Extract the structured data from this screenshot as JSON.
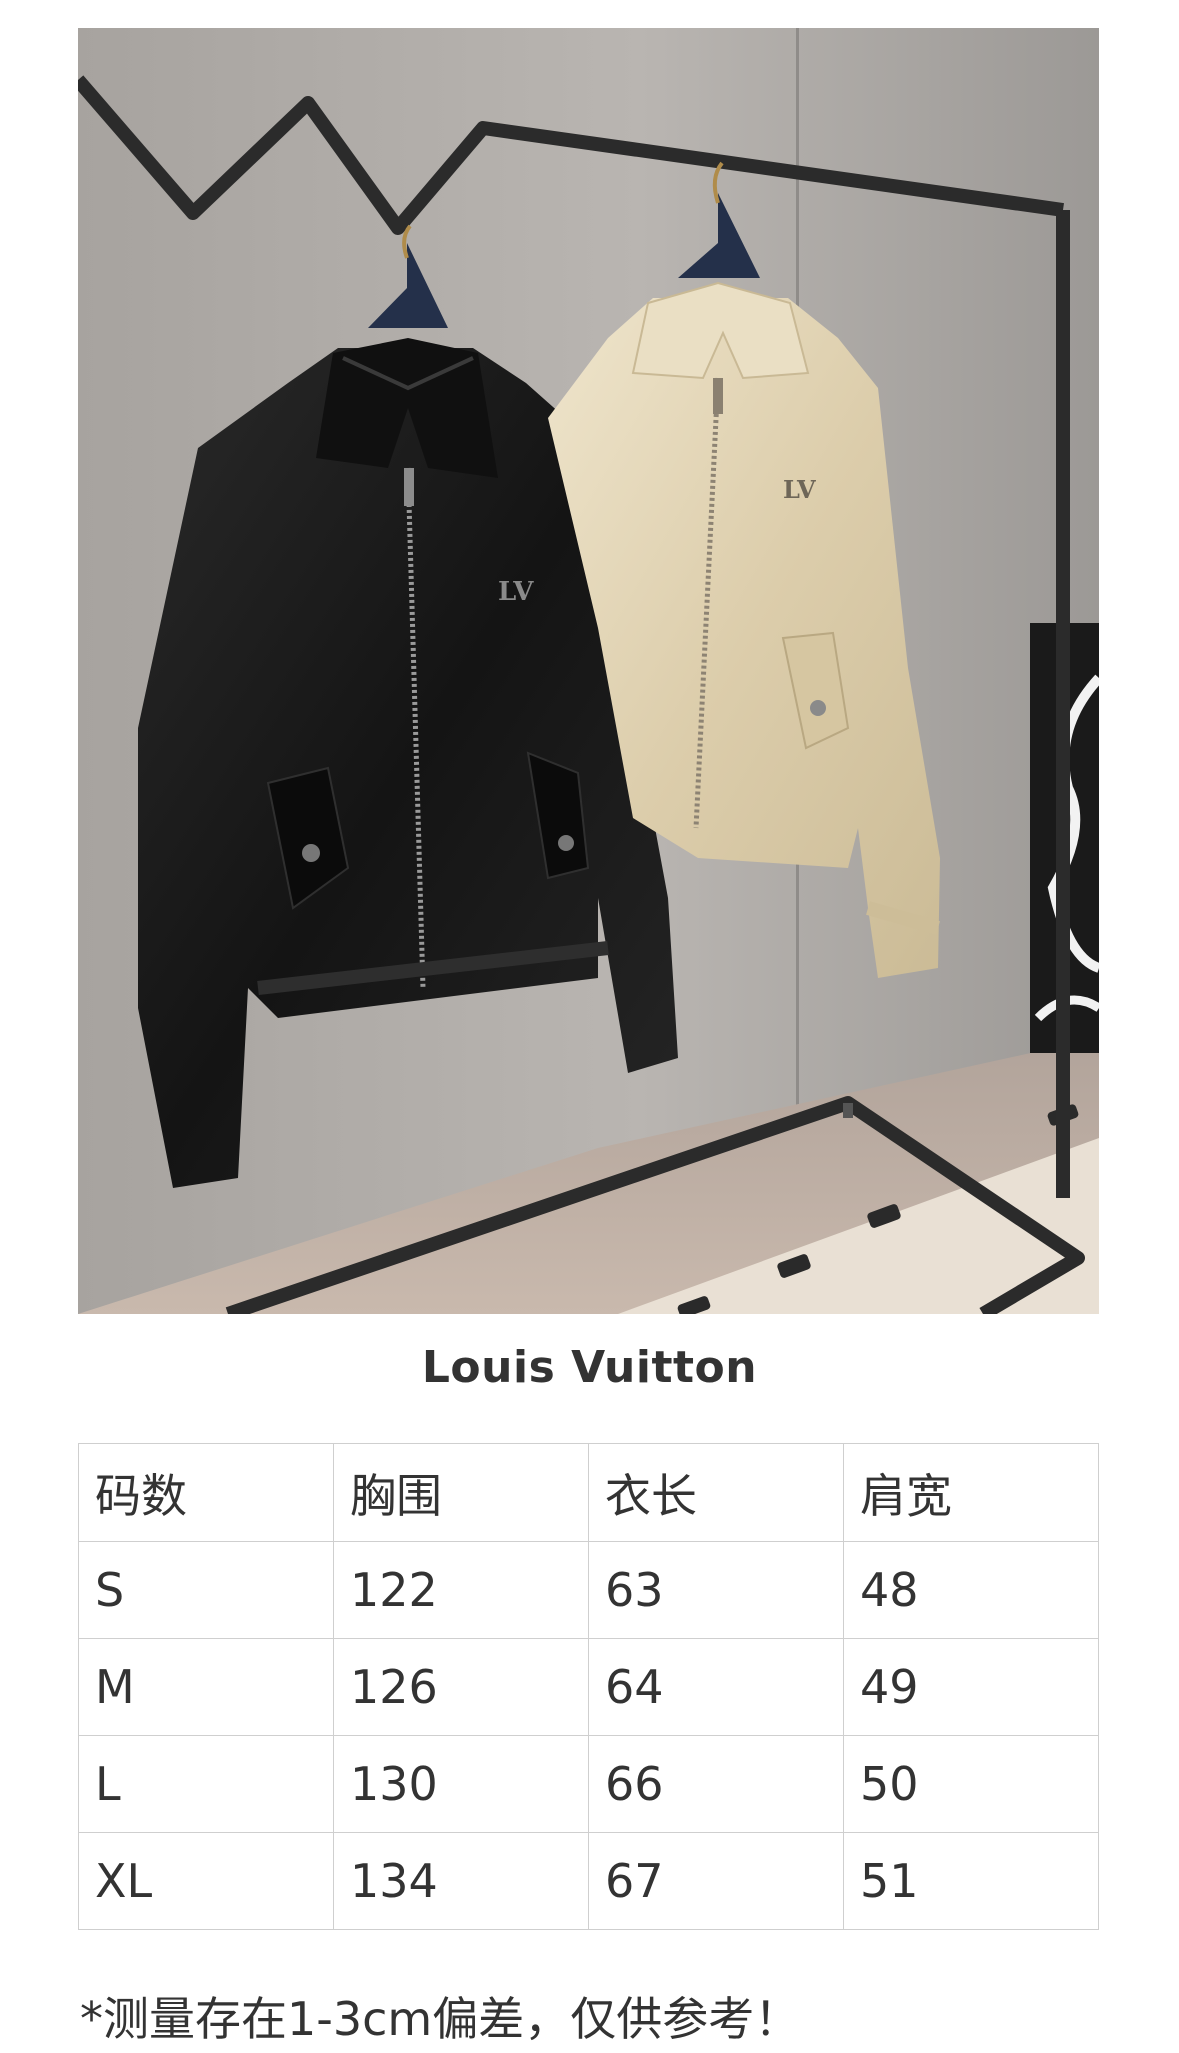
{
  "brand": "Louis Vuitton",
  "table": {
    "headers": [
      "码数",
      "胸围",
      "衣长",
      "肩宽"
    ],
    "rows": [
      [
        "S",
        "122",
        "63",
        "48"
      ],
      [
        "M",
        "126",
        "64",
        "49"
      ],
      [
        "L",
        "130",
        "66",
        "50"
      ],
      [
        "XL",
        "134",
        "67",
        "51"
      ]
    ]
  },
  "note": "*测量存在1-3cm偏差，仅供参考！",
  "colors": {
    "text": "#333333",
    "border": "#cfcfcf",
    "jacket_black": "#1c1c1c",
    "jacket_beige": "#e2d5b6"
  }
}
